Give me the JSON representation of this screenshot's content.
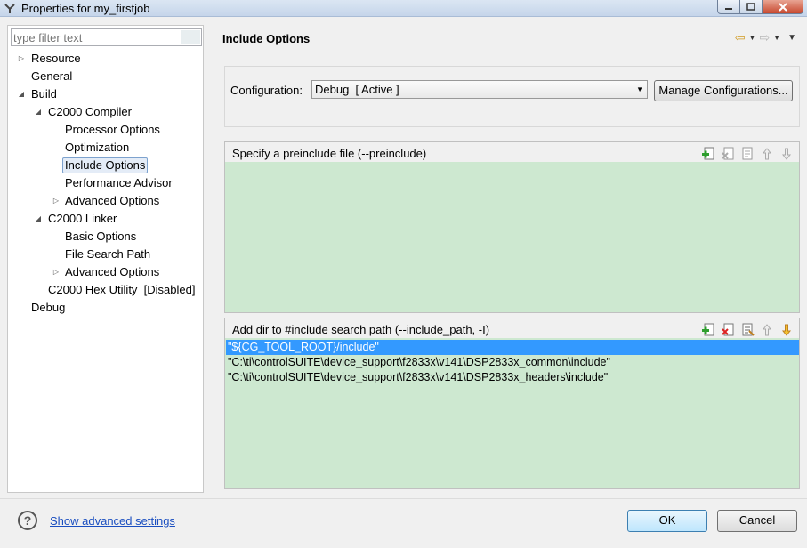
{
  "window": {
    "title": "Properties for my_firstjob",
    "controls": [
      "minimize",
      "maximize",
      "close"
    ]
  },
  "filter": {
    "placeholder": "type filter text",
    "value": ""
  },
  "tree": {
    "items": [
      {
        "label": "Resource",
        "level": 0,
        "expander": "collapsed"
      },
      {
        "label": "General",
        "level": 0,
        "expander": "none"
      },
      {
        "label": "Build",
        "level": 0,
        "expander": "expanded"
      },
      {
        "label": "C2000 Compiler",
        "level": 1,
        "expander": "expanded"
      },
      {
        "label": "Processor Options",
        "level": 2,
        "expander": "none"
      },
      {
        "label": "Optimization",
        "level": 2,
        "expander": "none"
      },
      {
        "label": "Include Options",
        "level": 2,
        "expander": "none",
        "selected": true
      },
      {
        "label": "Performance Advisor",
        "level": 2,
        "expander": "none"
      },
      {
        "label": "Advanced Options",
        "level": 2,
        "expander": "collapsed"
      },
      {
        "label": "C2000 Linker",
        "level": 1,
        "expander": "expanded"
      },
      {
        "label": "Basic Options",
        "level": 2,
        "expander": "none"
      },
      {
        "label": "File Search Path",
        "level": 2,
        "expander": "none"
      },
      {
        "label": "Advanced Options",
        "level": 2,
        "expander": "collapsed"
      },
      {
        "label": "C2000 Hex Utility  [Disabled]",
        "level": 1,
        "expander": "none"
      },
      {
        "label": "Debug",
        "level": 0,
        "expander": "none"
      }
    ]
  },
  "page": {
    "title": "Include Options"
  },
  "config": {
    "label": "Configuration:",
    "selected": "Debug  [ Active ]",
    "manage_label": "Manage Configurations..."
  },
  "preinclude": {
    "header": "Specify a preinclude file (--preinclude)",
    "items": []
  },
  "include_path": {
    "header": "Add dir to #include search path (--include_path, -I)",
    "items": [
      "\"${CG_TOOL_ROOT}/include\"",
      "\"C:\\ti\\controlSUITE\\device_support\\f2833x\\v141\\DSP2833x_common\\include\"",
      "\"C:\\ti\\controlSUITE\\device_support\\f2833x\\v141\\DSP2833x_headers\\include\""
    ],
    "selected_index": 0
  },
  "footer": {
    "advanced_link": "Show advanced settings",
    "ok": "OK",
    "cancel": "Cancel"
  },
  "colors": {
    "list_bg": "#cde8d0",
    "selection": "#3399ff",
    "link": "#1a4ec0"
  }
}
